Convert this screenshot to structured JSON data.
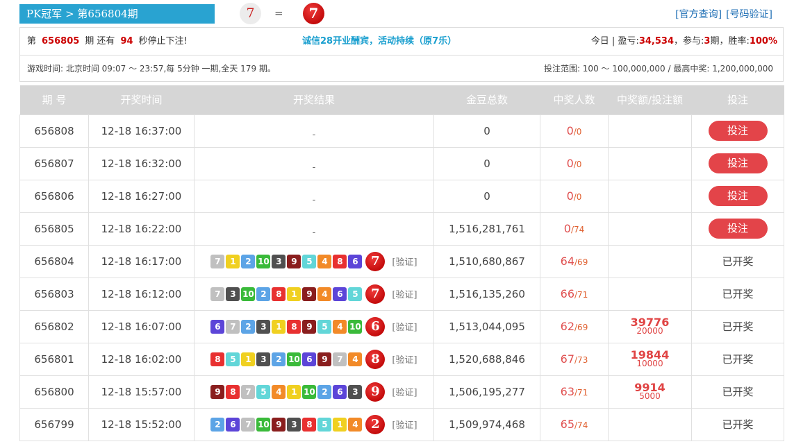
{
  "header": {
    "title": "PK冠军 > 第656804期",
    "last_number": "7",
    "equals": "=",
    "last_ball": "7",
    "link_official": "[官方查询]",
    "link_verify": "[号码验证]"
  },
  "info": {
    "issue_prefix": "第",
    "issue": "656805",
    "issue_mid": "期 还有",
    "seconds": "94",
    "issue_suffix": "秒停止下注!",
    "promo": "诚信28开业酬宾，活动持续（原7乐）",
    "today_label": "今日 | 盈亏:",
    "profit": "34,534",
    "join_label": "，参与:",
    "join": "3",
    "rate_label": "期，胜率:",
    "rate": "100%",
    "game_time": "游戏时间: 北京时间 09:07 ～ 23:57,每 5分钟 一期,全天 179 期。",
    "bet_range": "投注范围: 100 ～ 100,000,000 / 最高中奖: 1,200,000,000"
  },
  "table": {
    "headers": [
      "期 号",
      "开奖时间",
      "开奖结果",
      "金豆总数",
      "中奖人数",
      "中奖额/投注额",
      "投注"
    ],
    "dash": "-",
    "bet_label": "投注",
    "verify_label": "[验证]",
    "opened_label": "已开奖",
    "pending": [
      {
        "issue": "656808",
        "time": "12-18 16:37:00",
        "beans": "0",
        "winners": "0",
        "total": "/0"
      },
      {
        "issue": "656807",
        "time": "12-18 16:32:00",
        "beans": "0",
        "winners": "0",
        "total": "/0"
      },
      {
        "issue": "656806",
        "time": "12-18 16:27:00",
        "beans": "0",
        "winners": "0",
        "total": "/0"
      },
      {
        "issue": "656805",
        "time": "12-18 16:22:00",
        "beans": "1,516,281,761",
        "winners": "0",
        "total": "/74"
      }
    ],
    "drawn": [
      {
        "issue": "656804",
        "time": "12-18 16:17:00",
        "nums": [
          "7",
          "1",
          "2",
          "10",
          "3",
          "9",
          "5",
          "4",
          "8",
          "6"
        ],
        "sum": "7",
        "beans": "1,510,680,867",
        "winners": "64",
        "total": "/69",
        "win": "",
        "bet": ""
      },
      {
        "issue": "656803",
        "time": "12-18 16:12:00",
        "nums": [
          "7",
          "3",
          "10",
          "2",
          "8",
          "1",
          "9",
          "4",
          "6",
          "5"
        ],
        "sum": "7",
        "beans": "1,516,135,260",
        "winners": "66",
        "total": "/71",
        "win": "",
        "bet": ""
      },
      {
        "issue": "656802",
        "time": "12-18 16:07:00",
        "nums": [
          "6",
          "7",
          "2",
          "3",
          "1",
          "8",
          "9",
          "5",
          "4",
          "10"
        ],
        "sum": "6",
        "beans": "1,513,044,095",
        "winners": "62",
        "total": "/69",
        "win": "39776",
        "bet": "20000"
      },
      {
        "issue": "656801",
        "time": "12-18 16:02:00",
        "nums": [
          "8",
          "5",
          "1",
          "3",
          "2",
          "10",
          "6",
          "9",
          "7",
          "4"
        ],
        "sum": "8",
        "beans": "1,520,688,846",
        "winners": "67",
        "total": "/73",
        "win": "19844",
        "bet": "10000"
      },
      {
        "issue": "656800",
        "time": "12-18 15:57:00",
        "nums": [
          "9",
          "8",
          "7",
          "5",
          "4",
          "1",
          "10",
          "2",
          "6",
          "3"
        ],
        "sum": "9",
        "beans": "1,506,195,277",
        "winners": "63",
        "total": "/71",
        "win": "9914",
        "bet": "5000"
      },
      {
        "issue": "656799",
        "time": "12-18 15:52:00",
        "nums": [
          "2",
          "6",
          "7",
          "10",
          "9",
          "3",
          "8",
          "5",
          "1",
          "4"
        ],
        "sum": "2",
        "beans": "1,509,974,468",
        "winners": "65",
        "total": "/74",
        "win": "",
        "bet": ""
      }
    ]
  },
  "colors": {
    "title_tab": "#29a3d1",
    "accent_red": "#e34449",
    "link_blue": "#1f6fb5",
    "header_row": "#d6d6d6"
  }
}
